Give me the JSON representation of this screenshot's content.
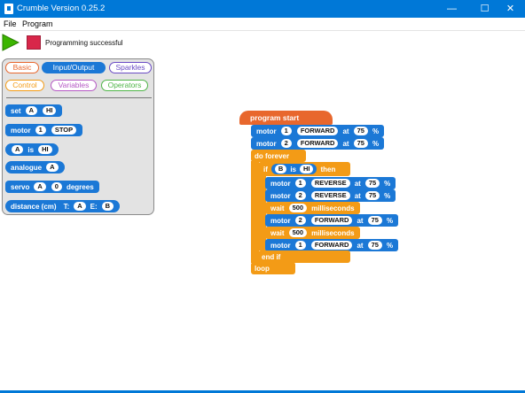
{
  "window": {
    "title": "Crumble Version 0.25.2",
    "minimize": "—",
    "maximize": "☐",
    "close": "✕"
  },
  "menu": {
    "file": "File",
    "program": "Program"
  },
  "toolbar": {
    "status": "Programming successful"
  },
  "palette": {
    "categories": {
      "basic": "Basic",
      "io": "Input/Output",
      "sparkles": "Sparkles",
      "control": "Control",
      "variables": "Variables",
      "operators": "Operators"
    },
    "set": {
      "label": "set",
      "a": "A",
      "b": "HI"
    },
    "motor": {
      "label": "motor",
      "num": "1",
      "state": "STOP"
    },
    "is": {
      "a": "A",
      "label": "is",
      "b": "HI"
    },
    "analogue": {
      "label": "analogue",
      "a": "A"
    },
    "servo": {
      "label": "servo",
      "a": "A",
      "val": "0",
      "unit": "degrees"
    },
    "distance": {
      "label": "distance (cm)",
      "t": "T:",
      "ta": "A",
      "e": "E:",
      "eb": "B"
    }
  },
  "program": {
    "start": "program start",
    "m1": {
      "label": "motor",
      "num": "1",
      "dir": "FORWARD",
      "at": "at",
      "speed": "75",
      "pct": "%"
    },
    "m2": {
      "label": "motor",
      "num": "2",
      "dir": "FORWARD",
      "at": "at",
      "speed": "75",
      "pct": "%"
    },
    "doforever": "do forever",
    "if": {
      "label": "if",
      "a": "B",
      "is": "is",
      "b": "HI",
      "then": "then"
    },
    "r1": {
      "label": "motor",
      "num": "1",
      "dir": "REVERSE",
      "at": "at",
      "speed": "75",
      "pct": "%"
    },
    "r2": {
      "label": "motor",
      "num": "2",
      "dir": "REVERSE",
      "at": "at",
      "speed": "75",
      "pct": "%"
    },
    "w1": {
      "label": "wait",
      "val": "500",
      "unit": "milliseconds"
    },
    "f2": {
      "label": "motor",
      "num": "2",
      "dir": "FORWARD",
      "at": "at",
      "speed": "75",
      "pct": "%"
    },
    "w2": {
      "label": "wait",
      "val": "500",
      "unit": "milliseconds"
    },
    "f1": {
      "label": "motor",
      "num": "1",
      "dir": "FORWARD",
      "at": "at",
      "speed": "75",
      "pct": "%"
    },
    "endif": "end if",
    "loop": "loop"
  },
  "colors": {
    "titlebar": "#0078d7",
    "motor_block": "#1b78d6",
    "control_block": "#f39b16",
    "start_block": "#e8672d",
    "stop_button": "#d8274a",
    "play_button": "#3cb500"
  }
}
